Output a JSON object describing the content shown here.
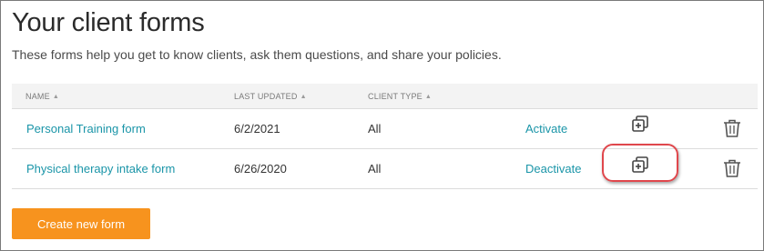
{
  "header": {
    "title": "Your client forms",
    "subtitle": "These forms help you get to know clients, ask them questions, and share your policies."
  },
  "table": {
    "columns": [
      {
        "label": "NAME",
        "sort_icon": "sort-icon"
      },
      {
        "label": "LAST UPDATED",
        "sort_icon": "sort-icon"
      },
      {
        "label": "CLIENT TYPE",
        "sort_icon": "sort-icon"
      }
    ],
    "rows": [
      {
        "name": "Personal Training form",
        "last_updated": "6/2/2021",
        "client_type": "All",
        "action": "Activate",
        "copy_icon": "duplicate-icon",
        "delete_icon": "trash-icon"
      },
      {
        "name": "Physical therapy intake form",
        "last_updated": "6/26/2020",
        "client_type": "All",
        "action": "Deactivate",
        "copy_icon": "duplicate-icon",
        "delete_icon": "trash-icon"
      }
    ]
  },
  "actions": {
    "create_label": "Create new form"
  },
  "colors": {
    "link": "#1a95a8",
    "button": "#f7931e",
    "highlight": "#e0474c"
  }
}
